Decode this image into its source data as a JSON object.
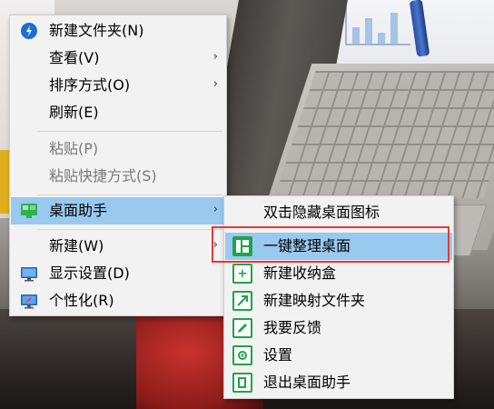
{
  "main_menu": {
    "items": [
      {
        "label": "新建文件夹(N)",
        "icon": "new-folder-icon"
      },
      {
        "label": "查看(V)",
        "has_submenu": true
      },
      {
        "label": "排序方式(O)",
        "has_submenu": true
      },
      {
        "label": "刷新(E)"
      },
      {
        "label": "粘贴(P)",
        "disabled": true
      },
      {
        "label": "粘贴快捷方式(S)",
        "disabled": true
      },
      {
        "label": "桌面助手",
        "has_submenu": true,
        "icon": "desktop-assistant-icon",
        "highlighted": true
      },
      {
        "label": "新建(W)",
        "has_submenu": true
      },
      {
        "label": "显示设置(D)",
        "icon": "display-settings-icon"
      },
      {
        "label": "个性化(R)",
        "icon": "personalize-icon"
      }
    ],
    "arrow": "›"
  },
  "sub_menu": {
    "items": [
      {
        "label": "双击隐藏桌面图标"
      },
      {
        "label": "一键整理桌面",
        "icon": "organize-desktop-icon",
        "highlighted": true
      },
      {
        "label": "新建收纳盒",
        "icon": "add-box-icon"
      },
      {
        "label": "新建映射文件夹",
        "icon": "map-folder-icon"
      },
      {
        "label": "我要反馈",
        "icon": "feedback-icon"
      },
      {
        "label": "设置",
        "icon": "settings-gear-icon"
      },
      {
        "label": "退出桌面助手",
        "icon": "exit-icon"
      }
    ]
  },
  "colors": {
    "highlight": "#99c9ef",
    "accent_green": "#1fa34a",
    "annotation_red": "#e53935"
  }
}
